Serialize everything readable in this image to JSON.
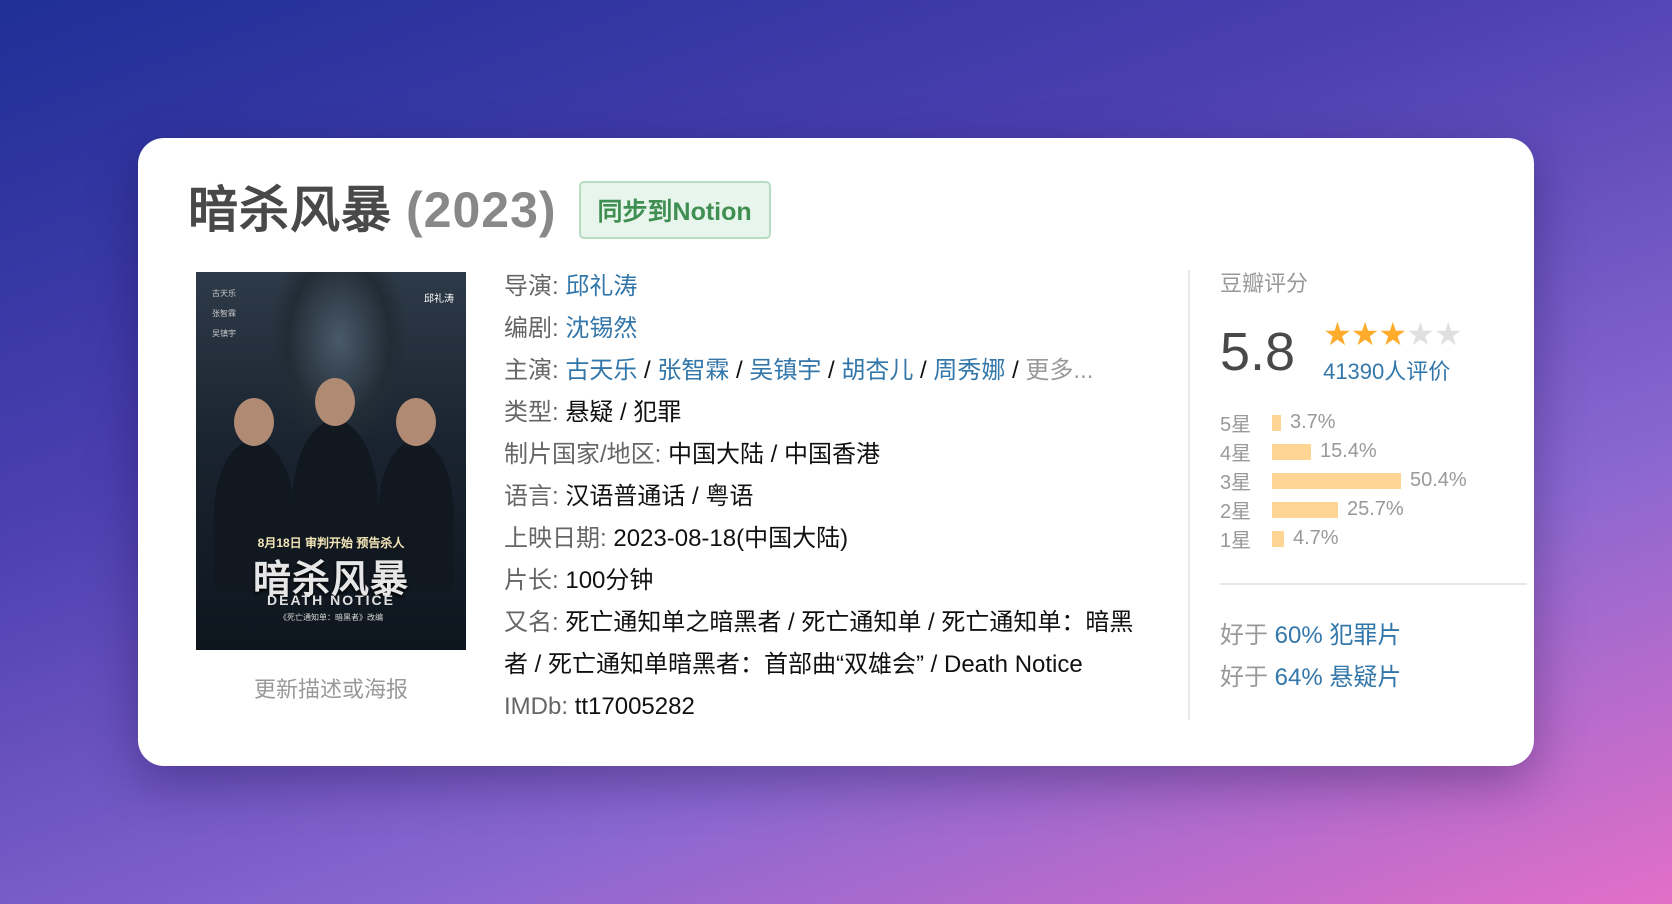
{
  "title": "暗杀风暴",
  "year": "(2023)",
  "notion_button": "同步到Notion",
  "poster": {
    "credits": [
      "古天乐",
      "张智霖",
      "吴镇宇"
    ],
    "director": "邱礼涛",
    "tagline": "8月18日 审判开始 预告杀人",
    "title": "暗杀风暴",
    "english": "DEATH NOTICE",
    "novel_line": "《死亡通知单：暗黑者》改编",
    "update_link": "更新描述或海报"
  },
  "info": {
    "director_label": "导演: ",
    "director": "邱礼涛",
    "writer_label": "编剧: ",
    "writer": "沈锡然",
    "cast_label": "主演: ",
    "cast": [
      "古天乐",
      "张智霖",
      "吴镇宇",
      "胡杏儿",
      "周秀娜"
    ],
    "cast_sep": " / ",
    "cast_more": "更多...",
    "genre_label": "类型: ",
    "genre": "悬疑 / 犯罪",
    "country_label": "制片国家/地区: ",
    "country": "中国大陆 / 中国香港",
    "language_label": "语言: ",
    "language": "汉语普通话 / 粤语",
    "release_label": "上映日期: ",
    "release": "2023-08-18(中国大陆)",
    "runtime_label": "片长: ",
    "runtime": "100分钟",
    "aka_label": "又名: ",
    "aka": "死亡通知单之暗黑者 / 死亡通知单 / 死亡通知单：暗黑者 / 死亡通知单暗黑者：首部曲“双雄会” / Death Notice",
    "imdb_label": "IMDb: ",
    "imdb": "tt17005282"
  },
  "rating": {
    "header": "豆瓣评分",
    "score": "5.8",
    "stars_filled": 3,
    "stars_total": 5,
    "count": "41390人评价",
    "distribution": [
      {
        "label": "5星",
        "pct": "3.7%",
        "value": 3.7
      },
      {
        "label": "4星",
        "pct": "15.4%",
        "value": 15.4
      },
      {
        "label": "3星",
        "pct": "50.4%",
        "value": 50.4
      },
      {
        "label": "2星",
        "pct": "25.7%",
        "value": 25.7
      },
      {
        "label": "1星",
        "pct": "4.7%",
        "value": 4.7
      }
    ],
    "better_than": [
      {
        "prefix": "好于 ",
        "link": "60% 犯罪片"
      },
      {
        "prefix": "好于 ",
        "link": "64% 悬疑片"
      }
    ]
  },
  "colors": {
    "link": "#3377aa",
    "star": "#ffac2d",
    "bar": "#ffd596",
    "notion_green": "#3f8f52"
  }
}
